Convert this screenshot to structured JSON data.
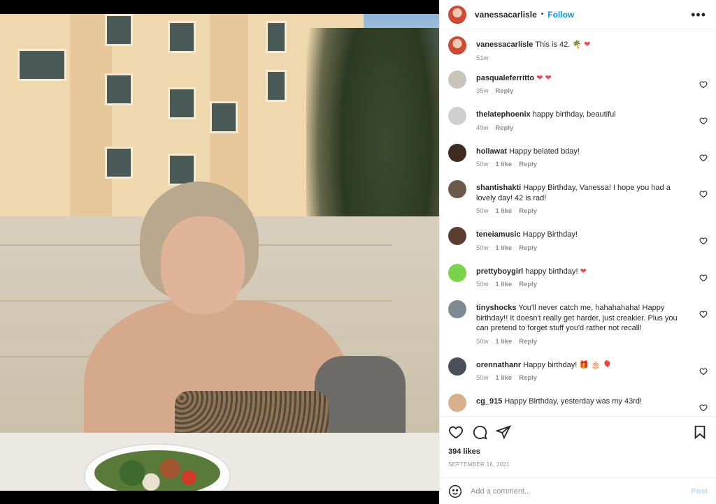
{
  "colors": {
    "accent": "#0095f6",
    "heart": "#ed4956",
    "muted": "#8e8e8e"
  },
  "header": {
    "username": "vanessacarlisle",
    "separator": "•",
    "follow_label": "Follow",
    "more_icon": "more-horizontal-icon"
  },
  "caption": {
    "username": "vanessacarlisle",
    "text": "This is 42. 🌴 ❤",
    "time": "51w"
  },
  "comments": [
    {
      "username": "pasqualeferritto",
      "text": "❤ ❤",
      "time": "35w",
      "likes": "",
      "reply": "Reply",
      "avatar_color": "#c9c4bc"
    },
    {
      "username": "thelatephoenix",
      "text": "happy birthday, beautiful",
      "time": "49w",
      "likes": "",
      "reply": "Reply",
      "avatar_color": "#cfcfcf"
    },
    {
      "username": "hollawat",
      "text": "Happy belated bday!",
      "time": "50w",
      "likes": "1 like",
      "reply": "Reply",
      "avatar_color": "#3d2b1f"
    },
    {
      "username": "shantishakti",
      "text": "Happy Birthday, Vanessa! I hope you had a lovely day! 42 is rad!",
      "time": "50w",
      "likes": "1 like",
      "reply": "Reply",
      "avatar_color": "#6b5a4a"
    },
    {
      "username": "teneiamusic",
      "text": "Happy Birthday!",
      "time": "50w",
      "likes": "1 like",
      "reply": "Reply",
      "avatar_color": "#5a3e32"
    },
    {
      "username": "prettyboygirl",
      "text": "happy birthday! ❤",
      "time": "50w",
      "likes": "1 like",
      "reply": "Reply",
      "avatar_color": "#7bd34a"
    },
    {
      "username": "tinyshocks",
      "text": "You'll never catch me, hahahahaha! Happy birthday!! It doesn't really get harder, just creakier. Plus you can pretend to forget stuff you'd rather not recall!",
      "time": "50w",
      "likes": "1 like",
      "reply": "Reply",
      "avatar_color": "#7d8a90"
    },
    {
      "username": "orennathanr",
      "text": "Happy birthday! 🎁 🎂 🎈",
      "time": "50w",
      "likes": "1 like",
      "reply": "Reply",
      "avatar_color": "#4a4f5a"
    },
    {
      "username": "cg_915",
      "text": "Happy Birthday, yesterday was my 43rd!",
      "time": "",
      "likes": "",
      "reply": "",
      "avatar_color": "#d9b08c"
    }
  ],
  "actions": {
    "like_icon": "heart-icon",
    "comment_icon": "comment-icon",
    "share_icon": "share-icon",
    "save_icon": "bookmark-icon"
  },
  "likes": "394 likes",
  "date": "SEPTEMBER 16, 2021",
  "add_comment": {
    "placeholder": "Add a comment...",
    "post_label": "Post",
    "emoji_icon": "smiley-icon"
  }
}
